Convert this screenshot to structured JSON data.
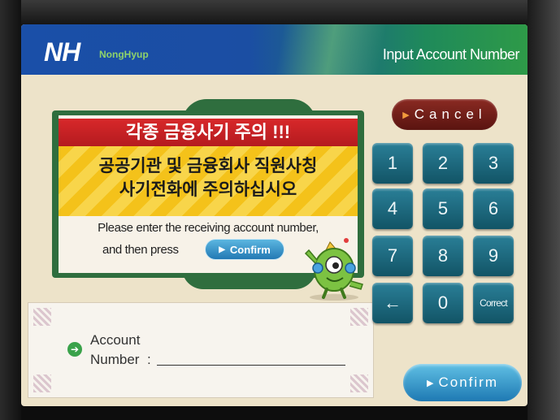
{
  "header": {
    "logo": "NH",
    "logo_sub": "NongHyup",
    "title": "Input Account Number"
  },
  "notice": {
    "title": "각종 금융사기 주의 !!!",
    "line1": "공공기관 및 금융회사 직원사칭",
    "line2": "사기전화에 주의하십시오",
    "instruction1": "Please enter the receiving account number,",
    "instruction2": "and then press",
    "inline_button": "Confirm"
  },
  "account": {
    "label_line1": "Account",
    "label_line2": "Number",
    "value": ""
  },
  "keypad": {
    "cancel": "Cancel",
    "keys": [
      "1",
      "2",
      "3",
      "4",
      "5",
      "6",
      "7",
      "8",
      "9",
      "←",
      "0",
      "Correct"
    ],
    "confirm": "Confirm"
  },
  "colors": {
    "header_blue": "#1a4fa8",
    "header_green": "#2e9a48",
    "key_teal": "#1f6f85",
    "cancel_red": "#7a2119",
    "confirm_blue": "#2a8cc4",
    "warning_red": "#c8222a",
    "warning_yellow": "#f4c21a"
  }
}
